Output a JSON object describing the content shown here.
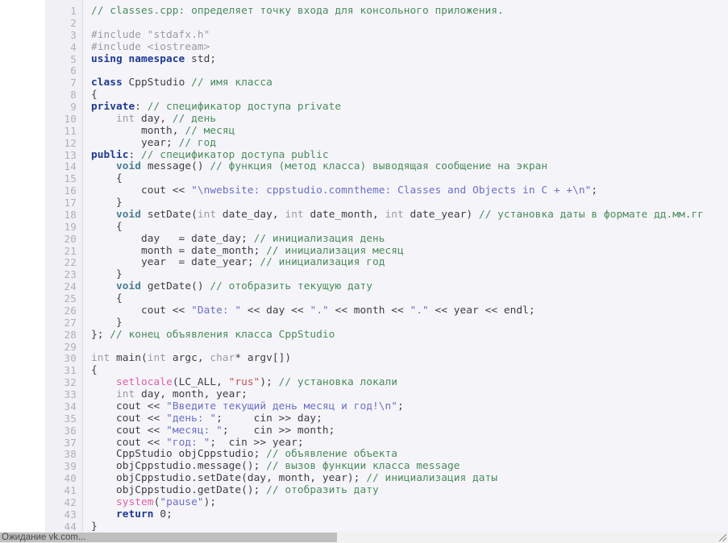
{
  "document": {
    "filename": "classes.cpp",
    "language": "C++",
    "total_lines_visible": 44
  },
  "colors": {
    "page_background": "#ffffff",
    "code_background": "#f5f5f9",
    "gutter_background": "#f0f0f5",
    "gutter_text": "#b0b0bb",
    "gutter_divider": "#dcdce4",
    "plain_text": "#3d3d45",
    "keyword": "#1f3a93",
    "keyword_type": "#4a7f94",
    "builtin_type": "#9a9aa5",
    "preprocessor": "#9a9aa5",
    "comment": "#4b8b5e",
    "string": "#6b6fc4",
    "string_red": "#cf4b4b",
    "function_highlight": "#e060a8",
    "scrollbar_track": "#f1f1f1",
    "scrollbar_thumb": "#bfbfbf"
  },
  "gutter": {
    "line_numbers": [
      "1",
      "2",
      "3",
      "4",
      "5",
      "6",
      "7",
      "8",
      "9",
      "10",
      "11",
      "12",
      "13",
      "14",
      "15",
      "16",
      "17",
      "18",
      "19",
      "20",
      "21",
      "22",
      "23",
      "24",
      "25",
      "26",
      "27",
      "28",
      "29",
      "30",
      "31",
      "32",
      "33",
      "34",
      "35",
      "36",
      "37",
      "38",
      "39",
      "40",
      "41",
      "42",
      "43",
      "44"
    ]
  },
  "code": {
    "lines": [
      {
        "n": "1",
        "plain": "// classes.cpp: определяет точку входа для консольного приложения.",
        "tokens": [
          {
            "t": "cmt",
            "s": "// classes.cpp: определяет точку входа для консольного приложения."
          }
        ]
      },
      {
        "n": "2",
        "plain": "",
        "tokens": [
          {
            "t": "pln",
            "s": ""
          }
        ]
      },
      {
        "n": "3",
        "plain": "#include \"stdafx.h\"",
        "tokens": [
          {
            "t": "pre",
            "s": "#include \"stdafx.h\""
          }
        ]
      },
      {
        "n": "4",
        "plain": "#include <iostream>",
        "tokens": [
          {
            "t": "pre",
            "s": "#include <iostream>"
          }
        ]
      },
      {
        "n": "5",
        "plain": "using namespace std;",
        "tokens": [
          {
            "t": "kw",
            "s": "using namespace"
          },
          {
            "t": "pln",
            "s": " std;"
          }
        ]
      },
      {
        "n": "6",
        "plain": "",
        "tokens": [
          {
            "t": "pln",
            "s": ""
          }
        ]
      },
      {
        "n": "7",
        "plain": "class CppStudio // имя класса",
        "tokens": [
          {
            "t": "kw",
            "s": "class"
          },
          {
            "t": "pln",
            "s": " CppStudio "
          },
          {
            "t": "cmt",
            "s": "// имя класса"
          }
        ]
      },
      {
        "n": "8",
        "plain": "{",
        "tokens": [
          {
            "t": "pln",
            "s": "{"
          }
        ]
      },
      {
        "n": "9",
        "plain": "private: // спецификатор доступа private",
        "tokens": [
          {
            "t": "kw",
            "s": "private"
          },
          {
            "t": "pln",
            "s": ": "
          },
          {
            "t": "cmt",
            "s": "// спецификатор доступа private"
          }
        ]
      },
      {
        "n": "10",
        "plain": "    int day, // день",
        "tokens": [
          {
            "t": "pln",
            "s": "    "
          },
          {
            "t": "typ",
            "s": "int"
          },
          {
            "t": "pln",
            "s": " day, "
          },
          {
            "t": "cmt",
            "s": "// день"
          }
        ]
      },
      {
        "n": "11",
        "plain": "        month, // месяц",
        "tokens": [
          {
            "t": "pln",
            "s": "        month, "
          },
          {
            "t": "cmt",
            "s": "// месяц"
          }
        ]
      },
      {
        "n": "12",
        "plain": "        year; // год",
        "tokens": [
          {
            "t": "pln",
            "s": "        year; "
          },
          {
            "t": "cmt",
            "s": "// год"
          }
        ]
      },
      {
        "n": "13",
        "plain": "public: // спецификатор доступа public",
        "tokens": [
          {
            "t": "kw",
            "s": "public"
          },
          {
            "t": "pln",
            "s": ": "
          },
          {
            "t": "cmt",
            "s": "// спецификатор доступа public"
          }
        ]
      },
      {
        "n": "14",
        "plain": "    void message() // функция (метод класса) выводящая сообщение на экран",
        "tokens": [
          {
            "t": "pln",
            "s": "    "
          },
          {
            "t": "kwt",
            "s": "void"
          },
          {
            "t": "pln",
            "s": " message() "
          },
          {
            "t": "cmt",
            "s": "// функция (метод класса) выводящая сообщение на экран"
          }
        ]
      },
      {
        "n": "15",
        "plain": "    {",
        "tokens": [
          {
            "t": "pln",
            "s": "    {"
          }
        ]
      },
      {
        "n": "16",
        "plain": "        cout << \"\\nwebsite: cppstudio.comntheme: Classes and Objects in C + +\\n\";",
        "tokens": [
          {
            "t": "pln",
            "s": "        cout << "
          },
          {
            "t": "str",
            "s": "\"\\nwebsite: cppstudio.comntheme: Classes and Objects in C + +\\n\""
          },
          {
            "t": "pln",
            "s": ";"
          }
        ]
      },
      {
        "n": "17",
        "plain": "    }",
        "tokens": [
          {
            "t": "pln",
            "s": "    }"
          }
        ]
      },
      {
        "n": "18",
        "plain": "    void setDate(int date_day, int date_month, int date_year) // установка даты в формате дд.мм.гг",
        "tokens": [
          {
            "t": "pln",
            "s": "    "
          },
          {
            "t": "kwt",
            "s": "void"
          },
          {
            "t": "pln",
            "s": " setDate("
          },
          {
            "t": "typ",
            "s": "int"
          },
          {
            "t": "pln",
            "s": " date_day, "
          },
          {
            "t": "typ",
            "s": "int"
          },
          {
            "t": "pln",
            "s": " date_month, "
          },
          {
            "t": "typ",
            "s": "int"
          },
          {
            "t": "pln",
            "s": " date_year) "
          },
          {
            "t": "cmt",
            "s": "// установка даты в формате дд.мм.гг"
          }
        ]
      },
      {
        "n": "19",
        "plain": "    {",
        "tokens": [
          {
            "t": "pln",
            "s": "    {"
          }
        ]
      },
      {
        "n": "20",
        "plain": "        day   = date_day; // инициализация день",
        "tokens": [
          {
            "t": "pln",
            "s": "        day   = date_day; "
          },
          {
            "t": "cmt",
            "s": "// инициализация день"
          }
        ]
      },
      {
        "n": "21",
        "plain": "        month = date_month; // инициализация месяц",
        "tokens": [
          {
            "t": "pln",
            "s": "        month = date_month; "
          },
          {
            "t": "cmt",
            "s": "// инициализация месяц"
          }
        ]
      },
      {
        "n": "22",
        "plain": "        year  = date_year; // инициализация год",
        "tokens": [
          {
            "t": "pln",
            "s": "        year  = date_year; "
          },
          {
            "t": "cmt",
            "s": "// инициализация год"
          }
        ]
      },
      {
        "n": "23",
        "plain": "    }",
        "tokens": [
          {
            "t": "pln",
            "s": "    }"
          }
        ]
      },
      {
        "n": "24",
        "plain": "    void getDate() // отобразить текущую дату",
        "tokens": [
          {
            "t": "pln",
            "s": "    "
          },
          {
            "t": "kwt",
            "s": "void"
          },
          {
            "t": "pln",
            "s": " getDate() "
          },
          {
            "t": "cmt",
            "s": "// отобразить текущую дату"
          }
        ]
      },
      {
        "n": "25",
        "plain": "    {",
        "tokens": [
          {
            "t": "pln",
            "s": "    {"
          }
        ]
      },
      {
        "n": "26",
        "plain": "        cout << \"Date: \" << day << \".\" << month << \".\" << year << endl;",
        "tokens": [
          {
            "t": "pln",
            "s": "        cout << "
          },
          {
            "t": "str",
            "s": "\"Date: \""
          },
          {
            "t": "pln",
            "s": " << day << "
          },
          {
            "t": "str",
            "s": "\".\""
          },
          {
            "t": "pln",
            "s": " << month << "
          },
          {
            "t": "str",
            "s": "\".\""
          },
          {
            "t": "pln",
            "s": " << year << endl;"
          }
        ]
      },
      {
        "n": "27",
        "plain": "    }",
        "tokens": [
          {
            "t": "pln",
            "s": "    }"
          }
        ]
      },
      {
        "n": "28",
        "plain": "}; // конец объявления класса CppStudio",
        "tokens": [
          {
            "t": "pln",
            "s": "}; "
          },
          {
            "t": "cmt",
            "s": "// конец объявления класса CppStudio"
          }
        ]
      },
      {
        "n": "29",
        "plain": "",
        "tokens": [
          {
            "t": "pln",
            "s": ""
          }
        ]
      },
      {
        "n": "30",
        "plain": "int main(int argc, char* argv[])",
        "tokens": [
          {
            "t": "typ",
            "s": "int"
          },
          {
            "t": "pln",
            "s": " main("
          },
          {
            "t": "typ",
            "s": "int"
          },
          {
            "t": "pln",
            "s": " argc, "
          },
          {
            "t": "typ",
            "s": "char"
          },
          {
            "t": "pln",
            "s": "* argv[])"
          }
        ]
      },
      {
        "n": "31",
        "plain": "{",
        "tokens": [
          {
            "t": "pln",
            "s": "{"
          }
        ]
      },
      {
        "n": "32",
        "plain": "    setlocale(LC_ALL, \"rus\"); // установка локали",
        "tokens": [
          {
            "t": "pln",
            "s": "    "
          },
          {
            "t": "fn",
            "s": "setlocale"
          },
          {
            "t": "pln",
            "s": "(LC_ALL, "
          },
          {
            "t": "strr",
            "s": "\"rus\""
          },
          {
            "t": "pln",
            "s": "); "
          },
          {
            "t": "cmt",
            "s": "// установка локали"
          }
        ]
      },
      {
        "n": "33",
        "plain": "    int day, month, year;",
        "tokens": [
          {
            "t": "pln",
            "s": "    "
          },
          {
            "t": "typ",
            "s": "int"
          },
          {
            "t": "pln",
            "s": " day, month, year;"
          }
        ]
      },
      {
        "n": "34",
        "plain": "    cout << \"Введите текущий день месяц и год!\\n\";",
        "tokens": [
          {
            "t": "pln",
            "s": "    cout << "
          },
          {
            "t": "str",
            "s": "\"Введите текущий день месяц и год!\\n\""
          },
          {
            "t": "pln",
            "s": ";"
          }
        ]
      },
      {
        "n": "35",
        "plain": "    cout << \"день: \";     cin >> day;",
        "tokens": [
          {
            "t": "pln",
            "s": "    cout << "
          },
          {
            "t": "str",
            "s": "\"день: \""
          },
          {
            "t": "pln",
            "s": ";     cin >> day;"
          }
        ]
      },
      {
        "n": "36",
        "plain": "    cout << \"месяц: \";    cin >> month;",
        "tokens": [
          {
            "t": "pln",
            "s": "    cout << "
          },
          {
            "t": "str",
            "s": "\"месяц: \""
          },
          {
            "t": "pln",
            "s": ";    cin >> month;"
          }
        ]
      },
      {
        "n": "37",
        "plain": "    cout << \"год: \";  cin >> year;",
        "tokens": [
          {
            "t": "pln",
            "s": "    cout << "
          },
          {
            "t": "str",
            "s": "\"год: \""
          },
          {
            "t": "pln",
            "s": ";  cin >> year;"
          }
        ]
      },
      {
        "n": "38",
        "plain": "    CppStudio objCppstudio; // объявление объекта",
        "tokens": [
          {
            "t": "pln",
            "s": "    CppStudio objCppstudio; "
          },
          {
            "t": "cmt",
            "s": "// объявление объекта"
          }
        ]
      },
      {
        "n": "39",
        "plain": "    objCppstudio.message(); // вызов функции класса message",
        "tokens": [
          {
            "t": "pln",
            "s": "    objCppstudio.message(); "
          },
          {
            "t": "cmt",
            "s": "// вызов функции класса message"
          }
        ]
      },
      {
        "n": "40",
        "plain": "    objCppstudio.setDate(day, month, year); // инициализация даты",
        "tokens": [
          {
            "t": "pln",
            "s": "    objCppstudio.setDate(day, month, year); "
          },
          {
            "t": "cmt",
            "s": "// инициализация даты"
          }
        ]
      },
      {
        "n": "41",
        "plain": "    objCppstudio.getDate(); // отобразить дату",
        "tokens": [
          {
            "t": "pln",
            "s": "    objCppstudio.getDate(); "
          },
          {
            "t": "cmt",
            "s": "// отобразить дату"
          }
        ]
      },
      {
        "n": "42",
        "plain": "    system(\"pause\");",
        "tokens": [
          {
            "t": "pln",
            "s": "    "
          },
          {
            "t": "fn",
            "s": "system"
          },
          {
            "t": "pln",
            "s": "("
          },
          {
            "t": "str",
            "s": "\"pause\""
          },
          {
            "t": "pln",
            "s": ");"
          }
        ]
      },
      {
        "n": "43",
        "plain": "    return 0;",
        "tokens": [
          {
            "t": "pln",
            "s": "    "
          },
          {
            "t": "kw",
            "s": "return"
          },
          {
            "t": "pln",
            "s": " 0;"
          }
        ]
      },
      {
        "n": "44",
        "plain": "}",
        "tokens": [
          {
            "t": "pln",
            "s": "}"
          }
        ]
      }
    ]
  },
  "status_bar": {
    "text": "Ожидание vk.com..."
  },
  "scrollbar": {
    "orientation": "horizontal",
    "thumb_fraction": "0.47"
  }
}
